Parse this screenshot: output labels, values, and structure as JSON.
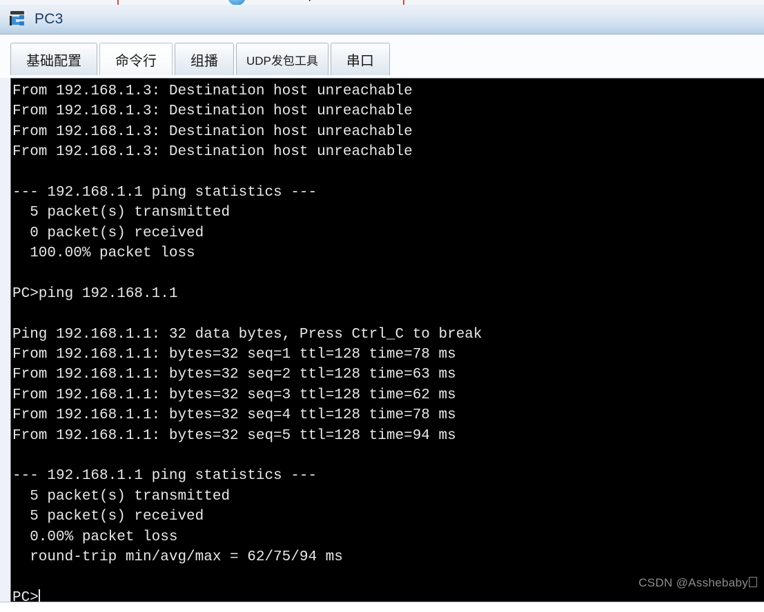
{
  "window": {
    "title": "PC3",
    "icon": "pc-host-icon"
  },
  "tabs": [
    {
      "label": "基础配置",
      "name": "tab-basic-config",
      "active": false,
      "small": false
    },
    {
      "label": "命令行",
      "name": "tab-command-line",
      "active": true,
      "small": false
    },
    {
      "label": "组播",
      "name": "tab-multicast",
      "active": false,
      "small": false
    },
    {
      "label": "UDP发包工具",
      "name": "tab-udp-sender",
      "active": false,
      "small": true
    },
    {
      "label": "串口",
      "name": "tab-serial-port",
      "active": false,
      "small": false
    }
  ],
  "terminal": {
    "lines": [
      "From 192.168.1.3: Destination host unreachable",
      "From 192.168.1.3: Destination host unreachable",
      "From 192.168.1.3: Destination host unreachable",
      "From 192.168.1.3: Destination host unreachable",
      "",
      "--- 192.168.1.1 ping statistics ---",
      "  5 packet(s) transmitted",
      "  0 packet(s) received",
      "  100.00% packet loss",
      "",
      "PC>ping 192.168.1.1",
      "",
      "Ping 192.168.1.1: 32 data bytes, Press Ctrl_C to break",
      "From 192.168.1.1: bytes=32 seq=1 ttl=128 time=78 ms",
      "From 192.168.1.1: bytes=32 seq=2 ttl=128 time=63 ms",
      "From 192.168.1.1: bytes=32 seq=3 ttl=128 time=62 ms",
      "From 192.168.1.1: bytes=32 seq=4 ttl=128 time=78 ms",
      "From 192.168.1.1: bytes=32 seq=5 ttl=128 time=94 ms",
      "",
      "--- 192.168.1.1 ping statistics ---",
      "  5 packet(s) transmitted",
      "  5 packet(s) received",
      "  0.00% packet loss",
      "  round-trip min/avg/max = 62/75/94 ms",
      ""
    ],
    "prompt": "PC>",
    "cursor_visible": true,
    "background_color": "#000000",
    "text_color": "#e8e8e8"
  },
  "watermark": {
    "text": "CSDN @Asshebaby"
  },
  "colors": {
    "titlebar_top": "#eaf0f8",
    "titlebar_bottom": "#b9cfe3",
    "title_text": "#1c3a63",
    "tab_border": "#a9b6c4",
    "panel_bg": "#fbfcfd"
  }
}
